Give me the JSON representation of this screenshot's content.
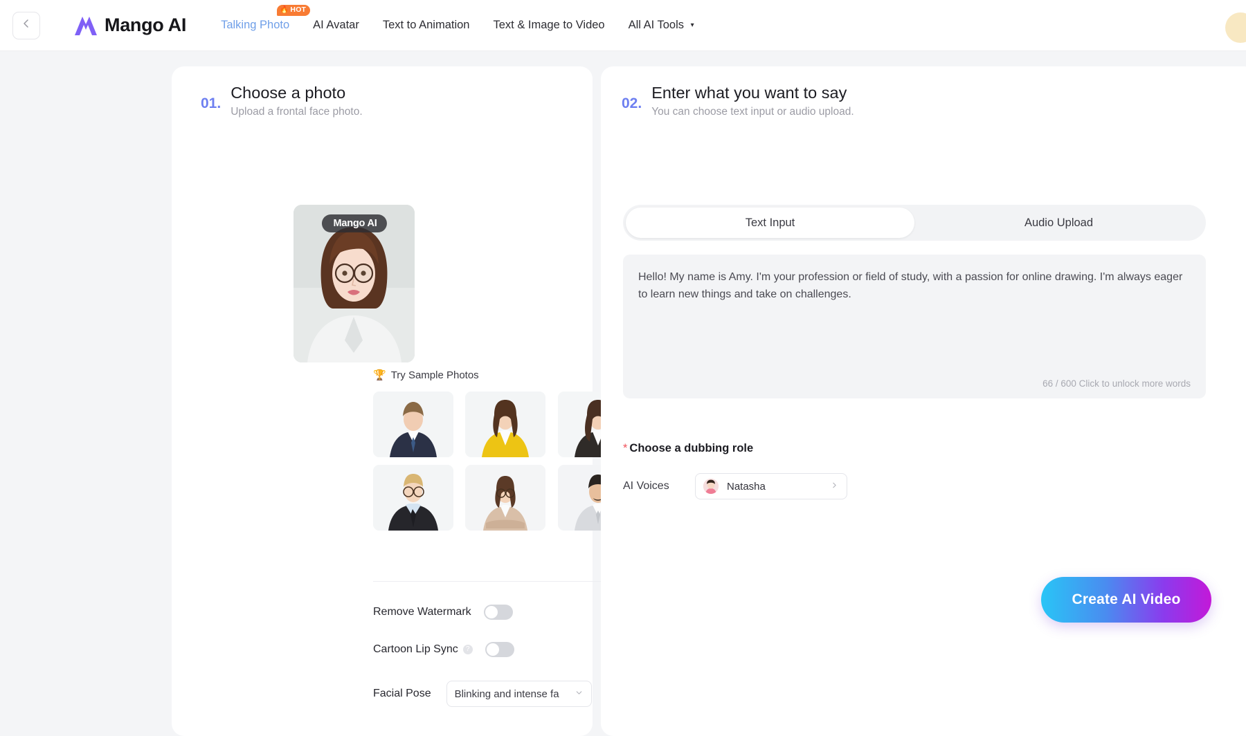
{
  "header": {
    "back_icon": "chevron-left-icon",
    "brand_name": "Mango AI",
    "nav": [
      {
        "label": "Talking Photo",
        "active": true,
        "badge": "HOT"
      },
      {
        "label": "AI Avatar",
        "active": false
      },
      {
        "label": "Text to Animation",
        "active": false
      },
      {
        "label": "Text & Image to Video",
        "active": false
      },
      {
        "label": "All AI Tools",
        "active": false,
        "caret": "▾"
      }
    ]
  },
  "step1": {
    "number": "01.",
    "title": "Choose a photo",
    "subtitle": "Upload a frontal face photo.",
    "watermark_text": "Mango AI",
    "samples_label": "Try Sample Photos",
    "samples_icon": "trophy-icon",
    "options": {
      "remove_watermark_label": "Remove Watermark",
      "remove_watermark_on": false,
      "cartoon_lip_sync_label": "Cartoon Lip Sync",
      "cartoon_lip_sync_on": false,
      "help_icon": "question-mark-icon",
      "facial_pose_label": "Facial Pose",
      "facial_pose_value": "Blinking and intense fa",
      "facial_pose_chevron": "chevron-down-icon"
    }
  },
  "step2": {
    "number": "02.",
    "title": "Enter what you want to say",
    "subtitle": "You can choose text input or audio upload.",
    "tabs": [
      {
        "label": "Text Input",
        "active": true
      },
      {
        "label": "Audio Upload",
        "active": false
      }
    ],
    "script_text": "Hello! My name is Amy. I'm your profession or field of study, with a passion for online drawing. I'm always eager to learn new things and take on challenges.",
    "counter": "66 / 600 Click to unlock more words",
    "dubbing": {
      "required_mark": "*",
      "section_label": "Choose a dubbing role",
      "voice_field_label": "AI Voices",
      "voice_name": "Natasha",
      "voice_chevron": "chevron-right-icon"
    }
  },
  "cta": {
    "label": "Create AI Video"
  },
  "colors": {
    "accent_step": "#6d7ff0",
    "nav_active": "#6f9fe8",
    "badge": "#f87b33",
    "required": "#f0525b",
    "cta_from": "#29c5f6",
    "cta_to": "#c319d8"
  }
}
